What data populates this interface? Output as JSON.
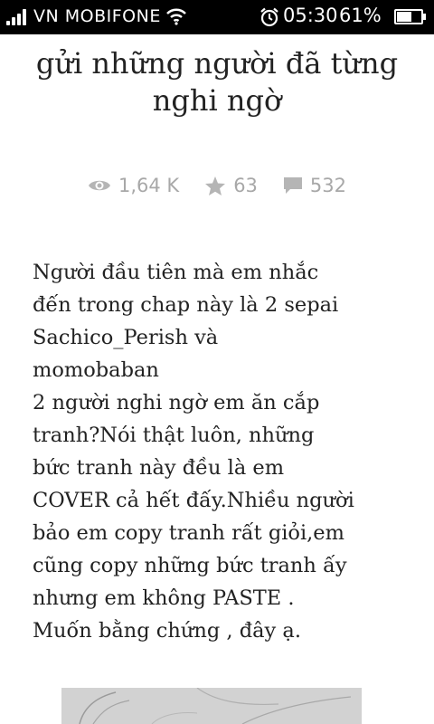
{
  "status_bar": {
    "carrier": "VN MOBIFONE",
    "time": "05:30",
    "battery_percent": "61%",
    "battery_level": 0.61,
    "icons": [
      "signal-icon",
      "wifi-icon",
      "alarm-icon",
      "battery-icon"
    ]
  },
  "story": {
    "title_lines": [
      "gửi những người đã từng",
      "nghi ngờ"
    ],
    "stats": {
      "views": "1,64 K",
      "votes": "63",
      "comments": "532"
    },
    "body_lines": [
      "Người đầu tiên mà em nhắc",
      "đến trong chap này là 2 sepai",
      "Sachico_Perish và",
      "momobaban",
      "2 người nghi ngờ em ăn cắp",
      "tranh?Nói thật luôn, những",
      "bức tranh này đều là em",
      "COVER cả hết đấy.Nhiều người",
      "bảo em copy tranh rất giỏi,em",
      "cũng copy những bức tranh ấy",
      "nhưng em không PASTE .",
      "Muốn bằng chứng , đây ạ."
    ]
  },
  "colors": {
    "status_bar_bg": "#000000",
    "text": "#222222",
    "stats": "#a8a8a8"
  }
}
